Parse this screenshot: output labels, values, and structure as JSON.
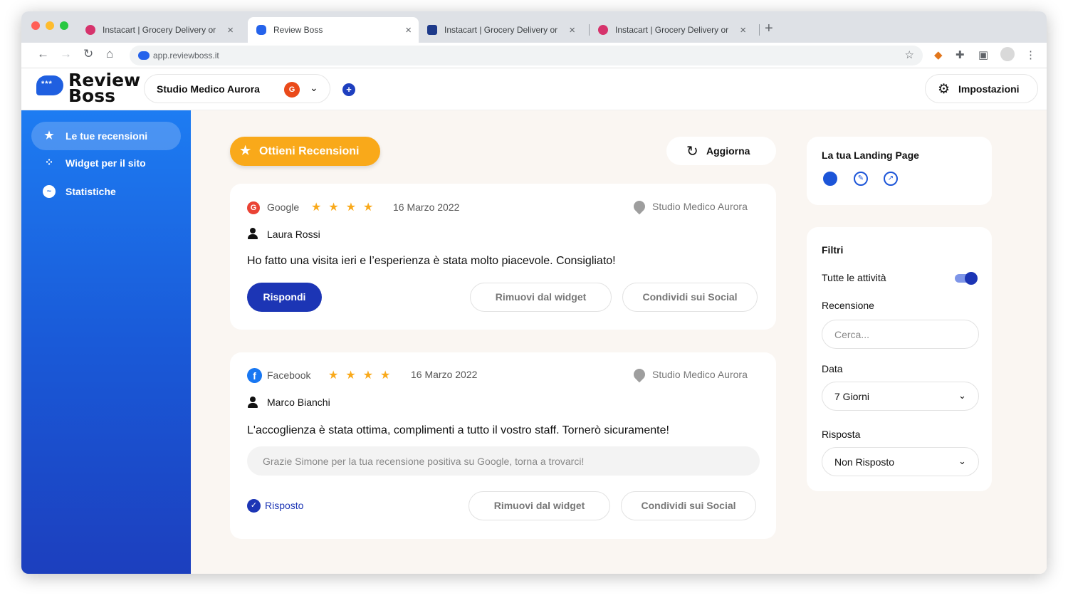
{
  "browser": {
    "tabs": [
      {
        "title": "Instacart | Grocery Delivery or",
        "favicon_color": "#d6336c"
      },
      {
        "title": "Review Boss",
        "favicon_color": "#2563eb"
      },
      {
        "title": "Instacart | Grocery Delivery or",
        "favicon_color": "#1e3a8a"
      },
      {
        "title": "Instacart | Grocery Delivery or",
        "favicon_color": "#d6336c"
      }
    ],
    "url": "app.reviewboss.it"
  },
  "header": {
    "logo_line1": "Review",
    "logo_line2": "Boss",
    "business": "Studio Medico Aurora",
    "business_badge": "G",
    "add_label": "+",
    "settings_label": "Impostazioni"
  },
  "sidebar": {
    "items": [
      {
        "label": "Le tue recensioni",
        "icon": "star-icon",
        "active": true
      },
      {
        "label": "Widget per il sito",
        "icon": "grid-icon",
        "active": false
      },
      {
        "label": "Statistiche",
        "icon": "chart-icon",
        "active": false
      }
    ]
  },
  "main": {
    "cta_label": "Ottieni Recensioni",
    "refresh_label": "Aggiorna",
    "reviews": [
      {
        "source": "Google",
        "stars": 4,
        "date": "16 Marzo 2022",
        "location": "Studio Medico Aurora",
        "author": "Laura Rossi",
        "text": "Ho fatto una visita ieri e l’esperienza è stata molto piacevole. Consigliato!",
        "reply_button": "Rispondi",
        "remove_label": "Rimuovi dal widget",
        "share_label": "Condividi sui Social"
      },
      {
        "source": "Facebook",
        "stars": 4,
        "date": "16 Marzo 2022",
        "location": "Studio Medico Aurora",
        "author": "Marco Bianchi",
        "text": "L'accoglienza è stata ottima, complimenti a tutto il vostro staff. Tornerò sicuramente!",
        "reply_text": "Grazie Simone per la tua recensione positiva su Google, torna a trovarci!",
        "replied_label": "Risposto",
        "remove_label": "Rimuovi dal widget",
        "share_label": "Condividi sui Social"
      }
    ]
  },
  "right": {
    "landing_title": "La tua Landing Page",
    "filters_title": "Filtri",
    "all_activities_label": "Tutte le attività",
    "all_activities_on": true,
    "review_label": "Recensione",
    "search_placeholder": "Cerca...",
    "date_label": "Data",
    "date_value": "7 Giorni",
    "response_label": "Risposta",
    "response_value": "Non Risposto"
  },
  "colors": {
    "brand_blue": "#1c35b5",
    "accent_orange": "#f9a91a",
    "google_red": "#ea4335",
    "facebook_blue": "#1877f2"
  }
}
